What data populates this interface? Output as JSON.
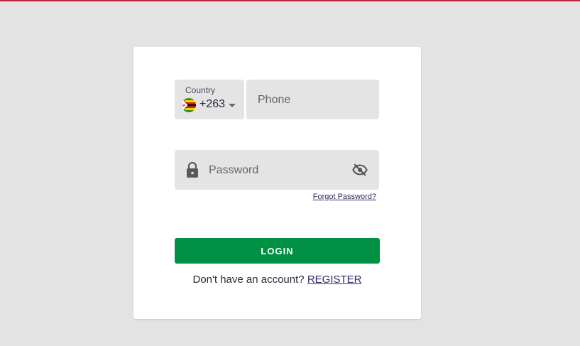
{
  "login_form": {
    "country_label": "Country",
    "country_code": "+263",
    "flag": "zimbabwe-flag",
    "phone_placeholder": "Phone",
    "password_placeholder": "Password",
    "forgot_password_label": "Forgot Password?",
    "login_label": "LOGIN",
    "register_prompt": "Don't have an account?",
    "register_label": "REGISTER"
  },
  "colors": {
    "accent": "#009144",
    "top_bar": "#b8283a",
    "background": "#e3e3e3",
    "field_background": "#e4e4e4"
  },
  "icons": {
    "lock": "lock-icon",
    "visibility": "eye-off-icon",
    "dropdown": "caret-down-icon"
  }
}
